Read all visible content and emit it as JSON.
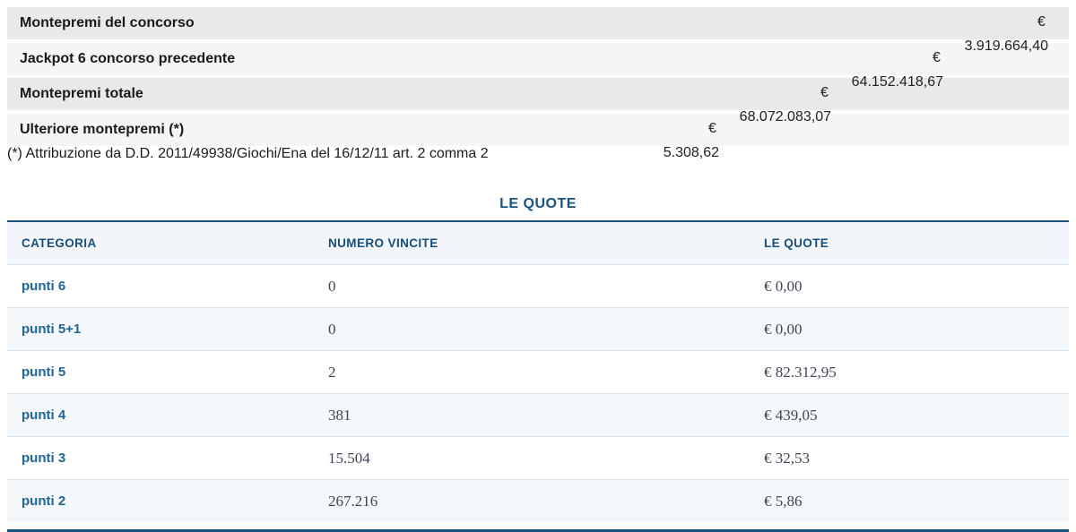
{
  "summary": {
    "currency_symbol": "€",
    "rows": [
      {
        "label": "Montepremi del concorso",
        "value": "3.919.664,40"
      },
      {
        "label": "Jackpot 6 concorso precedente",
        "value": "64.152.418,67"
      },
      {
        "label": "Montepremi totale",
        "value": "68.072.083,07"
      },
      {
        "label": "Ulteriore montepremi (*)",
        "value": "5.308,62"
      }
    ],
    "footnote": "(*) Attribuzione da D.D. 2011/49938/Giochi/Ena del 16/12/11 art. 2 comma 2"
  },
  "quote_table": {
    "title": "LE QUOTE",
    "columns": {
      "categoria": "CATEGORIA",
      "numero_vincite": "NUMERO VINCITE",
      "le_quote": "LE QUOTE"
    },
    "rows": [
      {
        "categoria": "punti 6",
        "numero_vincite": "0",
        "quota": "€ 0,00"
      },
      {
        "categoria": "punti 5+1",
        "numero_vincite": "0",
        "quota": "€ 0,00"
      },
      {
        "categoria": "punti 5",
        "numero_vincite": "2",
        "quota": "€ 82.312,95"
      },
      {
        "categoria": "punti 4",
        "numero_vincite": "381",
        "quota": "€ 439,05"
      },
      {
        "categoria": "punti 3",
        "numero_vincite": "15.504",
        "quota": "€ 32,53"
      },
      {
        "categoria": "punti 2",
        "numero_vincite": "267.216",
        "quota": "€ 5,86"
      }
    ]
  },
  "colors": {
    "table_blue": "#17537e",
    "header_text_blue": "#174e7c",
    "link_blue": "#1e6598",
    "serif_value": "#3f4457",
    "summary_row_dark": "#e9e9e9",
    "summary_row_light": "#f5f5f5",
    "alt_row_bg": "#f5f8fb",
    "separator": "#d9e3ee"
  }
}
